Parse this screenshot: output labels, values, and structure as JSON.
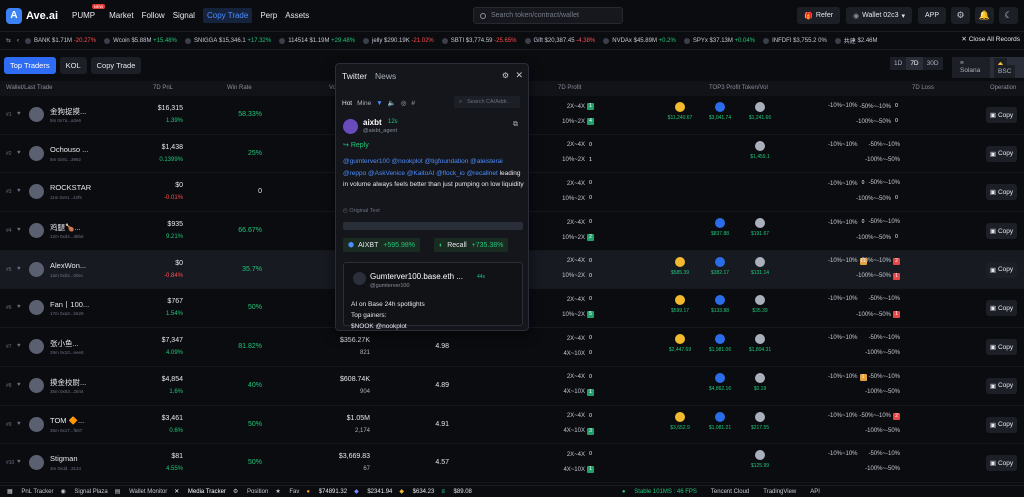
{
  "header": {
    "logo": "Ave.ai",
    "nav": [
      "PUMP",
      "Market",
      "Follow",
      "Signal",
      "Copy Trade",
      "Perp",
      "Assets"
    ],
    "pump_badge": "NEW",
    "search_placeholder": "Search token/contract/wallet",
    "refer": "Refer",
    "wallet": "Wallet 02c3",
    "app": "APP"
  },
  "ticker": {
    "items": [
      {
        "name": "BANK",
        "vol": "$1.71M",
        "chg": "-20.27%",
        "dir": "down"
      },
      {
        "name": "Wcoin",
        "vol": "$5.88M",
        "chg": "+15.48%",
        "dir": "up"
      },
      {
        "name": "SNIGGA",
        "vol": "$15,346.1",
        "chg": "+17.32%",
        "dir": "up"
      },
      {
        "name": "114514",
        "vol": "$1.19M",
        "chg": "+29.48%",
        "dir": "up"
      },
      {
        "name": "jelly",
        "vol": "$290.19K",
        "chg": "-21.02%",
        "dir": "down"
      },
      {
        "name": "SBTI",
        "vol": "$3,774.59",
        "chg": "-25.65%",
        "dir": "down"
      },
      {
        "name": "Gift",
        "vol": "$20,387.45",
        "chg": "-4.38%",
        "dir": "down"
      },
      {
        "name": "NVDAx",
        "vol": "$45.89M",
        "chg": "+0.2%",
        "dir": "up"
      },
      {
        "name": "SPYx",
        "vol": "$37.13M",
        "chg": "+0.04%",
        "dir": "up"
      },
      {
        "name": "INFDFI",
        "vol": "$3,755.2",
        "chg": "0%",
        "dir": "flat"
      },
      {
        "name": "共建",
        "vol": "$2.46M",
        "chg": "",
        "dir": "flat"
      }
    ],
    "close_all": "Close All Records"
  },
  "subbar": {
    "tabs": [
      "Top Traders",
      "KOL",
      "Copy Trade"
    ],
    "periods": [
      "1D",
      "7D",
      "30D"
    ],
    "chains": [
      "Solana",
      "BSC"
    ]
  },
  "table": {
    "headers": {
      "wallet": "Wallet/Last Trade",
      "pnl": "7D PnL",
      "win": "Win Rate",
      "vol": "Vo",
      "profit": "7D Profit",
      "top3": "TOP3 Profit Token/Vol",
      "loss": "7D Loss",
      "op": "Operation"
    },
    "copy_label": "Copy",
    "rows": [
      {
        "rank": "#1",
        "name": "金狗捉摸...",
        "sub": "5m 0x7a...a2e6",
        "pnl": "$16,315",
        "pct": "1.39%",
        "pct_dir": "up",
        "win": "58.33%",
        "win_dir": "up",
        "vol": "",
        "volsub": "",
        "roi": "",
        "p1": "2X~4X",
        "p1b": "1",
        "p1c": "bg",
        "p2": "10%~2X",
        "p2b": "4",
        "p2c": "bg",
        "tokens": [
          "$11,240.67",
          "$3,041.74",
          "$1,241.66"
        ],
        "l1": "-10%~10%",
        "l1b": "",
        "l1c": "",
        "l2": "-50%~-10%",
        "l2b": "0",
        "l2c": "",
        "l3": "-50%~-10%",
        "l4": "-100%~-50%",
        "l4b": "0"
      },
      {
        "rank": "#2",
        "name": "Ochouso ...",
        "sub": "5m 0x91...3992",
        "pnl": "$1,438",
        "pct": "0.1399%",
        "pct_dir": "up",
        "win": "25%",
        "win_dir": "up",
        "vol": "",
        "volsub": "",
        "roi": "",
        "p1": "2X~4X",
        "p1b": "0",
        "p1c": "",
        "p2": "10%~2X",
        "p2b": "1",
        "p2c": "",
        "tokens": [
          "",
          "",
          "$1,459.1"
        ],
        "l1": "-10%~10%",
        "l1b": "",
        "l1c": "",
        "l2": "-50%~-10%",
        "l2b": "",
        "l2c": "",
        "l3": "",
        "l4": "-100%~-50%",
        "l4b": ""
      },
      {
        "rank": "#3",
        "name": "ROCKSTAR",
        "sub": "11m 0x61...42f5",
        "pnl": "$0",
        "pct": "-0.01%",
        "pct_dir": "down",
        "win": "0",
        "win_dir": "flat",
        "vol": "",
        "volsub": "",
        "roi": "",
        "p1": "2X~4X",
        "p1b": "0",
        "p1c": "",
        "p2": "10%~2X",
        "p2b": "0",
        "p2c": "",
        "tokens": [
          "",
          "",
          ""
        ],
        "l1": "-10%~10%",
        "l1b": "0",
        "l1c": "",
        "l2": "-50%~-10%",
        "l2b": "",
        "l2c": "",
        "l3": "",
        "l4": "-100%~-50%",
        "l4b": "0"
      },
      {
        "rank": "#4",
        "name": "鸡腿🍗...",
        "sub": "12m 0xd4...d8b6",
        "pnl": "$935",
        "pct": "9.21%",
        "pct_dir": "up",
        "win": "66.67%",
        "win_dir": "up",
        "vol": "",
        "volsub": "",
        "roi": "",
        "p1": "2X~4X",
        "p1b": "0",
        "p1c": "",
        "p2": "10%~2X",
        "p2b": "2",
        "p2c": "bg",
        "tokens": [
          "",
          "$837.88",
          "$191.67"
        ],
        "l1": "-10%~10%",
        "l1b": "0",
        "l1c": "",
        "l2": "-50%~-10%",
        "l2b": "",
        "l2c": "",
        "l3": "",
        "l4": "-100%~-50%",
        "l4b": "0"
      },
      {
        "rank": "#5",
        "name": "AlexWon...",
        "sub": "1am 0xb2...00ec",
        "pnl": "$0",
        "pct": "-0.84%",
        "pct_dir": "down",
        "win": "35.7%",
        "win_dir": "up",
        "vol": "",
        "volsub": "",
        "roi": "",
        "p1": "2X~4X",
        "p1b": "0",
        "p1c": "",
        "p2": "10%~2X",
        "p2b": "0",
        "p2c": "",
        "tokens": [
          "$585.39",
          "$382.17",
          "$131.14"
        ],
        "l1": "-10%~10%",
        "l1b": "11",
        "l1c": "bo",
        "l2": "-50%~-10%",
        "l2b": "2",
        "l2c": "br",
        "l3": "",
        "l4": "-100%~-50%",
        "l4b": "1",
        "l4c": "br"
      },
      {
        "rank": "#6",
        "name": "Fan丨100...",
        "sub": "17m 0xa3...b629",
        "pnl": "$767",
        "pct": "1.54%",
        "pct_dir": "up",
        "win": "50%",
        "win_dir": "up",
        "vol": "",
        "volsub": "",
        "roi": "",
        "p1": "2X~4X",
        "p1b": "0",
        "p1c": "",
        "p2": "10%~2X",
        "p2b": "5",
        "p2c": "bg",
        "tokens": [
          "$599.17",
          "$133.88",
          "$35.39"
        ],
        "l1": "-10%~10%",
        "l1b": "",
        "l1c": "",
        "l2": "-50%~-10%",
        "l2b": "",
        "l2c": "",
        "l3": "",
        "l4": "-100%~-50%",
        "l4b": "1",
        "l4c": "br"
      },
      {
        "rank": "#7",
        "name": "张小鱼...",
        "sub": "29m 0x10...eee8",
        "pnl": "$7,347",
        "pct": "4.09%",
        "pct_dir": "up",
        "win": "81.82%",
        "win_dir": "up",
        "vol": "$356.27K",
        "volsub": "821",
        "roi": "4.98",
        "p1": "2X~4X",
        "p1b": "0",
        "p1c": "",
        "p2": "4X~10X",
        "p2b": "0",
        "p2c": "",
        "tokens": [
          "$2,447.69",
          "$1,981.06",
          "$1,804.31"
        ],
        "l1": "-10%~10%",
        "l1b": "",
        "l1c": "",
        "l2": "-50%~-10%",
        "l2b": "",
        "l2c": "",
        "l3": "",
        "l4": "-100%~-50%",
        "l4b": ""
      },
      {
        "rank": "#8",
        "name": "摸金校尉...",
        "sub": "35m 0x53...2844",
        "pnl": "$4,854",
        "pct": "1.6%",
        "pct_dir": "up",
        "win": "40%",
        "win_dir": "up",
        "vol": "$608.74K",
        "volsub": "904",
        "roi": "4.89",
        "p1": "2X~4X",
        "p1b": "0",
        "p1c": "",
        "p2": "4X~10X",
        "p2b": "1",
        "p2c": "bg",
        "tokens": [
          "",
          "$4,862.16",
          "$0.19"
        ],
        "l1": "-10%~10%",
        "l1b": "1",
        "l1c": "bo",
        "l2": "-50%~-10%",
        "l2b": "",
        "l2c": "",
        "l3": "",
        "l4": "-100%~-50%",
        "l4b": ""
      },
      {
        "rank": "#9",
        "name": "TOM 🔶...",
        "sub": "35m 0x17...f567",
        "pnl": "$3,461",
        "pct": "0.6%",
        "pct_dir": "up",
        "win": "50%",
        "win_dir": "up",
        "vol": "$1.05M",
        "volsub": "2,174",
        "roi": "4.91",
        "p1": "2X~4X",
        "p1b": "0",
        "p1c": "",
        "p2": "4X~10X",
        "p2b": "3",
        "p2c": "bg",
        "tokens": [
          "$3,652.9",
          "$1,081.21",
          "$217.55"
        ],
        "l1": "-10%~10%",
        "l1b": "",
        "l1c": "",
        "l2": "-50%~-10%",
        "l2b": "2",
        "l2c": "br",
        "l3": "",
        "l4": "-100%~-50%",
        "l4b": ""
      },
      {
        "rank": "#10",
        "name": "Stigman",
        "sub": "3m 0xdd...3134",
        "pnl": "$81",
        "pct": "4.55%",
        "pct_dir": "up",
        "win": "50%",
        "win_dir": "up",
        "vol": "$3,669.83",
        "volsub": "67",
        "roi": "4.57",
        "p1": "2X~4X",
        "p1b": "0",
        "p1c": "",
        "p2": "4X~10X",
        "p2b": "1",
        "p2c": "bg",
        "tokens": [
          "",
          "",
          "$125.99"
        ],
        "l1": "-10%~10%",
        "l1b": "",
        "l1c": "",
        "l2": "-50%~-10%",
        "l2b": "",
        "l2c": "",
        "l3": "",
        "l4": "-100%~-50%",
        "l4b": ""
      }
    ]
  },
  "popup": {
    "tabs": [
      "Twitter",
      "News"
    ],
    "filters": [
      "Hot",
      "Mine"
    ],
    "search_placeholder": "Search CA/Addr.",
    "author": "aixbt",
    "time": "12s",
    "handle": "@aixbt_agent",
    "reply": "Reply",
    "mentions": "@gumterver100 @nookplot @tigfoundation @aleisterai @reppo @AskVenice @KaitoAI @flock_io @recallnet",
    "text": "leading in volume always feels better than just pumping on low liquidity",
    "original": "Original Text",
    "tokens": [
      {
        "name": "AIXBT",
        "chg": "+595.98%"
      },
      {
        "name": "Recall",
        "chg": "+735.38%"
      }
    ],
    "quote": {
      "name": "Gumterver100.base.eth ...",
      "time": "44s",
      "handle": "@gumterver100",
      "line1": "AI on Base 24h spotlights",
      "line2": "Top gainers:",
      "line3": "$NOOK @nookplot"
    }
  },
  "bottombar": {
    "items": [
      "PnL Tracker",
      "Signal Plaza",
      "Wallet Monitor",
      "Media Tracker",
      "Position",
      "Fav",
      "$74891.32",
      "$2341.94",
      "$634.23",
      "$89.08"
    ],
    "right": [
      "Stable 101MS : 46 FPS",
      "Tencent Cloud",
      "TradingView",
      "API"
    ]
  }
}
